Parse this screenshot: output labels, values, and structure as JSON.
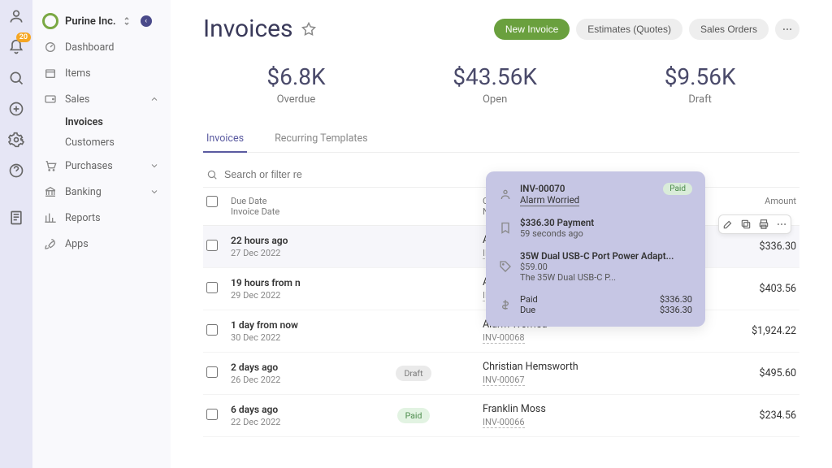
{
  "rail": {
    "badge": "20"
  },
  "org": {
    "name": "Purine Inc."
  },
  "nav": {
    "dashboard": "Dashboard",
    "items": "Items",
    "sales": "Sales",
    "invoices": "Invoices",
    "customers": "Customers",
    "purchases": "Purchases",
    "banking": "Banking",
    "reports": "Reports",
    "apps": "Apps"
  },
  "page": {
    "title": "Invoices",
    "actions": {
      "new_invoice": "New Invoice",
      "estimates": "Estimates (Quotes)",
      "sales_orders": "Sales Orders"
    }
  },
  "stats": [
    {
      "value": "$6.8K",
      "label": "Overdue"
    },
    {
      "value": "$43.56K",
      "label": "Open"
    },
    {
      "value": "$9.56K",
      "label": "Draft"
    }
  ],
  "tabs": {
    "invoices": "Invoices",
    "recurring": "Recurring Templates"
  },
  "search": {
    "placeholder": "Search or filter re"
  },
  "thead": {
    "due": "Due Date",
    "invoice_date": "Invoice Date",
    "customer": "Customer",
    "number": "Number",
    "amount": "Amount"
  },
  "rows": [
    {
      "due": "22 hours ago",
      "date": "27 Dec 2022",
      "status": "",
      "customer": "Alarm Worried",
      "number": "INV-00070",
      "amount": "$336.30"
    },
    {
      "due": "19 hours from n",
      "date": "29 Dec 2022",
      "status": "",
      "customer": "Alarm Worried",
      "number": "INV-00069",
      "amount": "$403.56"
    },
    {
      "due": "1 day from now",
      "date": "30 Dec 2022",
      "status": "",
      "customer": "Alarm Worried",
      "number": "INV-00068",
      "amount": "$1,924.22"
    },
    {
      "due": "2 days ago",
      "date": "26 Dec 2022",
      "status": "Draft",
      "customer": "Christian Hemsworth",
      "number": "INV-00067",
      "amount": "$495.60"
    },
    {
      "due": "6 days ago",
      "date": "22 Dec 2022",
      "status": "Paid",
      "customer": "Franklin Moss",
      "number": "INV-00066",
      "amount": "$234.56"
    }
  ],
  "popover": {
    "invoice": "INV-00070",
    "customer": "Alarm Worried",
    "status": "Paid",
    "payment_line": "$336.30 Payment",
    "payment_time": "59 seconds ago",
    "product_title": "35W Dual USB-C Port Power Adapt...",
    "product_price": "$59.00",
    "product_desc": "The 35W Dual USB-C P...",
    "paid_label": "Paid",
    "paid_amount": "$336.30",
    "due_label": "Due",
    "due_amount": "$336.30"
  }
}
